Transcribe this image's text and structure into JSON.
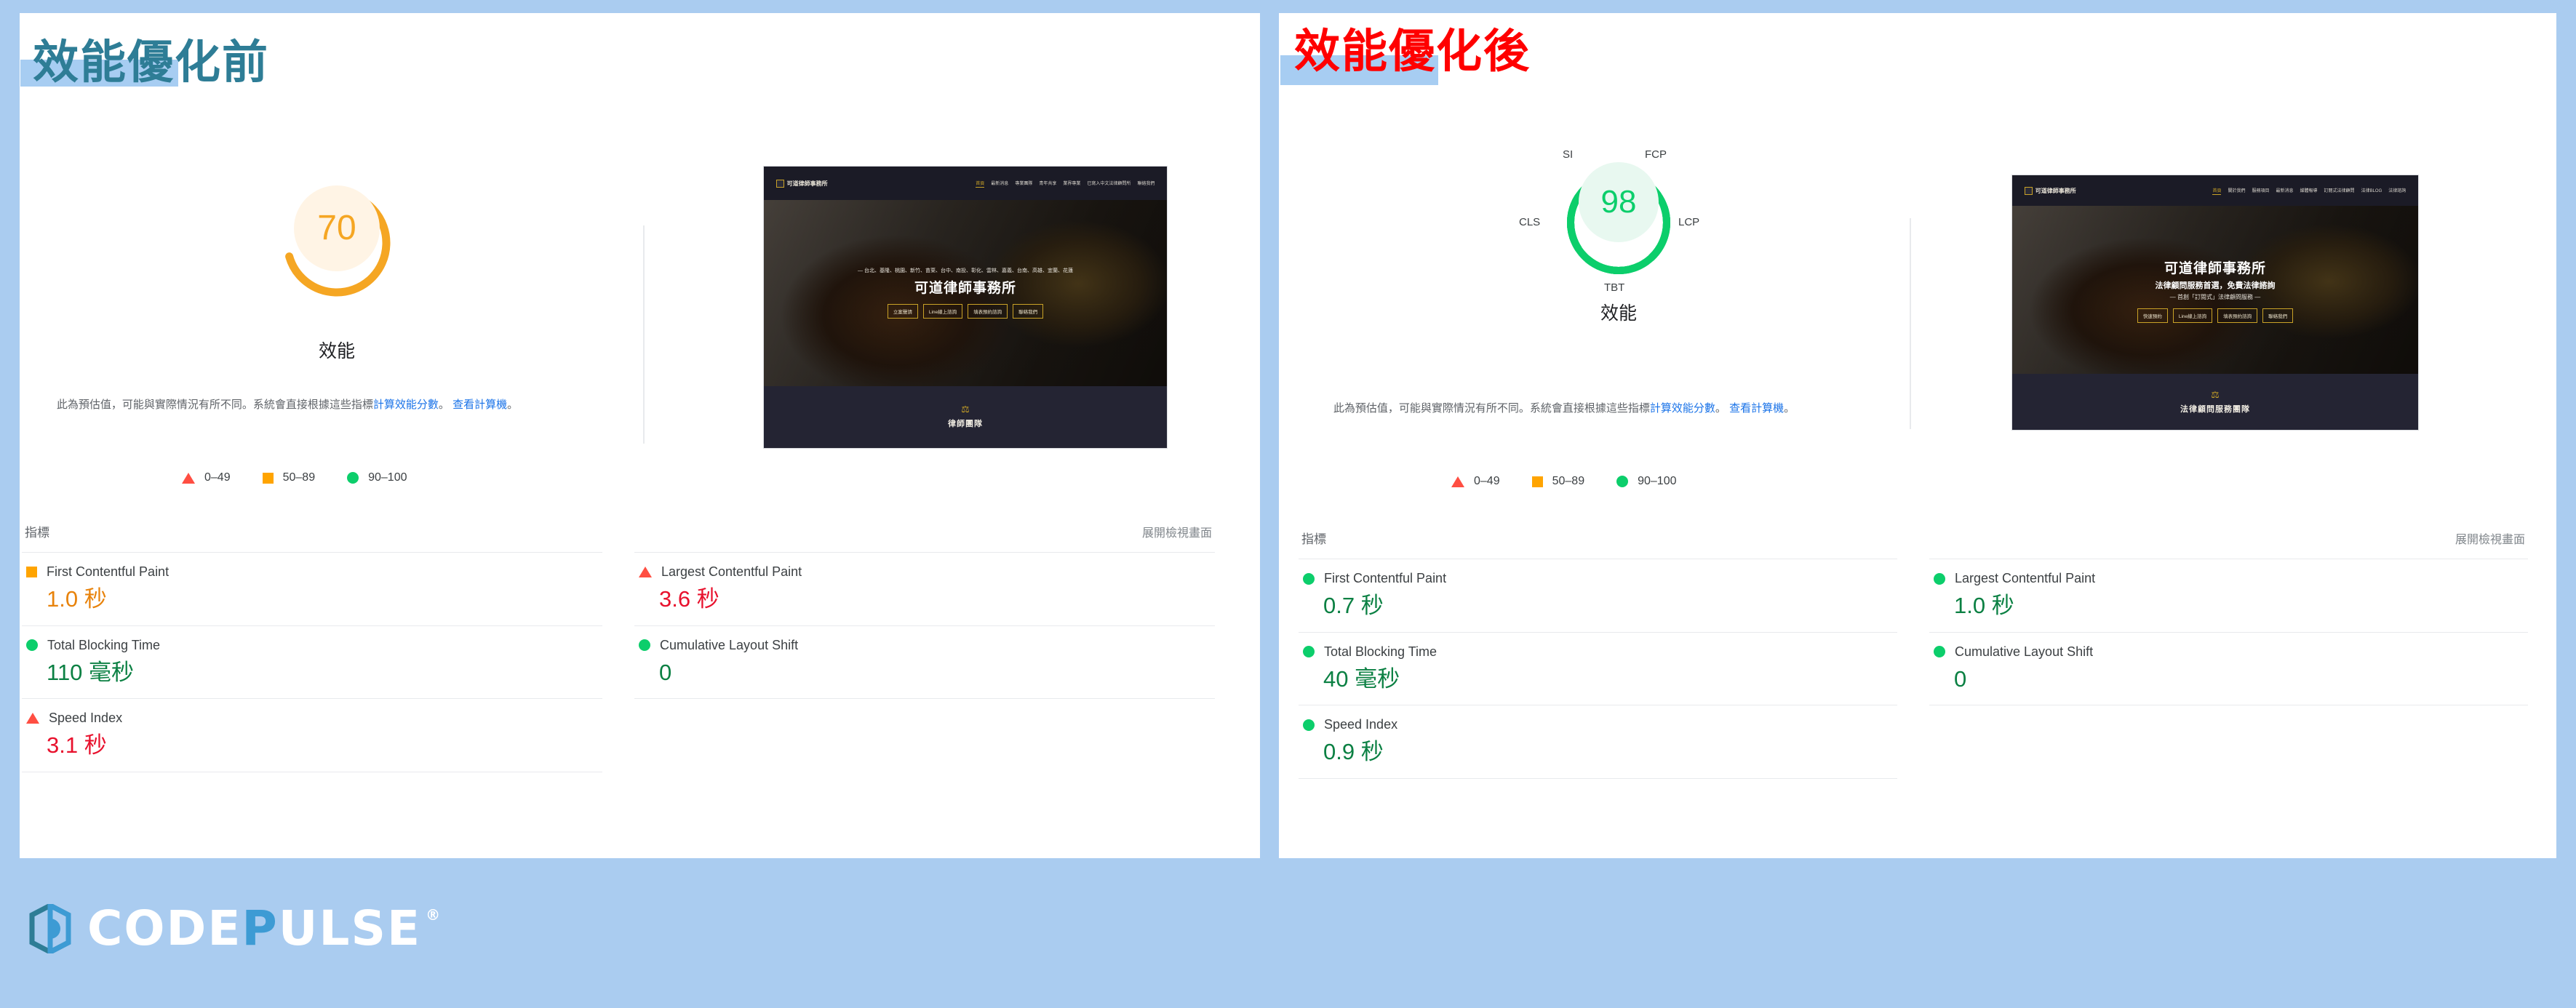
{
  "page": {
    "background_color": "#AACCF0",
    "highlight_color": "#A7CDF2"
  },
  "panels": [
    {
      "id": "before",
      "title": "效能優化前",
      "title_color": "#2E7D96",
      "gauge": {
        "score": "70",
        "caption": "效能",
        "color": "#F5A623",
        "fill": "#FFF4E5",
        "tick_labels": []
      },
      "description": {
        "text_1": "此為預估值，可能與實際情況有所不同。系統會直接根據這些指標",
        "link_1": "計算效能分數",
        "text_2": "。",
        "link_2": "查看計算機",
        "text_3": "。"
      },
      "legend": [
        {
          "icon": "triangle-icon",
          "color": "#FF4E42",
          "label": "0–49"
        },
        {
          "icon": "square-icon",
          "color": "#FFA400",
          "label": "50–89"
        },
        {
          "icon": "circle-icon",
          "color": "#0CCE6B",
          "label": "90–100"
        }
      ],
      "metrics_header": {
        "label": "指標",
        "link": "展開檢視畫面"
      },
      "metrics_left": [
        {
          "icon": "square-icon",
          "icon_color": "#FFA400",
          "name": "First Contentful Paint",
          "value": "1.0 秒",
          "value_class": "mv-orange"
        },
        {
          "icon": "circle-icon",
          "icon_color": "#0CCE6B",
          "name": "Total Blocking Time",
          "value": "110 毫秒",
          "value_class": "mv-green"
        },
        {
          "icon": "triangle-icon",
          "icon_color": "#FF4E42",
          "name": "Speed Index",
          "value": "3.1 秒",
          "value_class": "mv-red"
        }
      ],
      "metrics_right": [
        {
          "icon": "triangle-icon",
          "icon_color": "#FF4E42",
          "name": "Largest Contentful Paint",
          "value": "3.6 秒",
          "value_class": "mv-red"
        },
        {
          "icon": "circle-icon",
          "icon_color": "#0CCE6B",
          "name": "Cumulative Layout Shift",
          "value": "0",
          "value_class": "mv-green"
        }
      ],
      "thumbnail": {
        "logo_text": "可道律師事務所",
        "nav": [
          "首頁",
          "最新消息",
          "專業團隊",
          "青年共享",
          "業界專業",
          "已寫入中文法律顧問所",
          "聯絡我們"
        ],
        "hero_kicker": "— 台北、基隆、桃園、新竹、苗栗、台中、南投、彰化、雲林、嘉義、台南、高雄、宜蘭、花蓮",
        "hero_title": "可道律師事務所",
        "hero_sub1": "",
        "hero_sub2": "",
        "hero_buttons": [
          "立案聲請",
          "Line線上諮詢",
          "填表預約諮詢",
          "聯絡我們"
        ],
        "section_title": "律師團隊"
      }
    },
    {
      "id": "after",
      "title": "效能優化後",
      "title_color": "#FF0000",
      "gauge": {
        "score": "98",
        "caption": "效能",
        "color": "#0CCE6B",
        "fill": "#E8F8F0",
        "tick_labels": [
          "SI",
          "FCP",
          "LCP",
          "TBT",
          "CLS"
        ]
      },
      "description": {
        "text_1": "此為預估值，可能與實際情況有所不同。系統會直接根據這些指標",
        "link_1": "計算效能分數",
        "text_2": "。",
        "link_2": "查看計算機",
        "text_3": "。"
      },
      "legend": [
        {
          "icon": "triangle-icon",
          "color": "#FF4E42",
          "label": "0–49"
        },
        {
          "icon": "square-icon",
          "color": "#FFA400",
          "label": "50–89"
        },
        {
          "icon": "circle-icon",
          "color": "#0CCE6B",
          "label": "90–100"
        }
      ],
      "metrics_header": {
        "label": "指標",
        "link": "展開檢視畫面"
      },
      "metrics_left": [
        {
          "icon": "circle-icon",
          "icon_color": "#0CCE6B",
          "name": "First Contentful Paint",
          "value": "0.7 秒",
          "value_class": "mv-green"
        },
        {
          "icon": "circle-icon",
          "icon_color": "#0CCE6B",
          "name": "Total Blocking Time",
          "value": "40 毫秒",
          "value_class": "mv-green"
        },
        {
          "icon": "circle-icon",
          "icon_color": "#0CCE6B",
          "name": "Speed Index",
          "value": "0.9 秒",
          "value_class": "mv-green"
        }
      ],
      "metrics_right": [
        {
          "icon": "circle-icon",
          "icon_color": "#0CCE6B",
          "name": "Largest Contentful Paint",
          "value": "1.0 秒",
          "value_class": "mv-green"
        },
        {
          "icon": "circle-icon",
          "icon_color": "#0CCE6B",
          "name": "Cumulative Layout Shift",
          "value": "0",
          "value_class": "mv-green"
        }
      ],
      "thumbnail": {
        "logo_text": "可道律師事務所",
        "nav": [
          "首頁",
          "關於我們",
          "服務項目",
          "最新消息",
          "媒體報導",
          "訂閱式法律顧問",
          "法律BLOG",
          "法律諮詢"
        ],
        "hero_kicker": "",
        "hero_title": "可道律師事務所",
        "hero_sub1": "法律顧問服務首選，免費法律諮詢",
        "hero_sub2": "— 首創「訂閱式」法律顧問服務 —",
        "hero_buttons": [
          "快速預約",
          "Line線上諮詢",
          "填表預約諮詢",
          "聯絡我們"
        ],
        "section_title": "法律顧問服務團隊"
      }
    }
  ],
  "footer": {
    "brand_part_1": "CODE",
    "brand_part_2": "P",
    "brand_part_3": "ULSE",
    "registered_mark": "®"
  }
}
